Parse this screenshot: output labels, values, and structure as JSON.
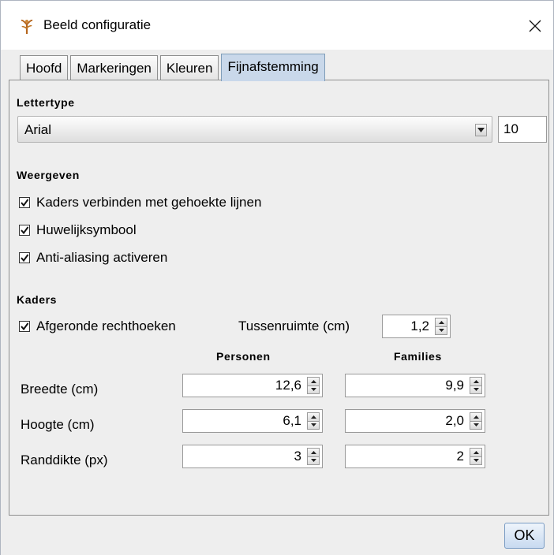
{
  "window": {
    "title": "Beeld configuratie"
  },
  "tabs": [
    {
      "label": "Hoofd",
      "active": false
    },
    {
      "label": "Markeringen",
      "active": false
    },
    {
      "label": "Kleuren",
      "active": false
    },
    {
      "label": "Fijnafstemming",
      "active": true
    }
  ],
  "font_section": {
    "heading": "Lettertype",
    "font_name": "Arial",
    "font_size": "10"
  },
  "display_section": {
    "heading": "Weergeven",
    "options": [
      {
        "label": "Kaders verbinden met gehoekte lijnen",
        "checked": true
      },
      {
        "label": "Huwelijksymbool",
        "checked": true
      },
      {
        "label": "Anti-aliasing activeren",
        "checked": true
      }
    ]
  },
  "boxes_section": {
    "heading": "Kaders",
    "rounded": {
      "label": "Afgeronde rechthoeken",
      "checked": true
    },
    "spacing": {
      "label": "Tussenruimte (cm)",
      "value": "1,2"
    },
    "col_persons": "Personen",
    "col_families": "Families",
    "rows": [
      {
        "label": "Breedte (cm)",
        "persons": "12,6",
        "families": "9,9"
      },
      {
        "label": "Hoogte (cm)",
        "persons": "6,1",
        "families": "2,0"
      },
      {
        "label": "Randdikte (px)",
        "persons": "3",
        "families": "2"
      }
    ]
  },
  "buttons": {
    "ok": "OK"
  },
  "colors": {
    "active_tab": "#c9d8ea",
    "panel_bg": "#eeeeee",
    "ok_button": "#c8daf0"
  }
}
